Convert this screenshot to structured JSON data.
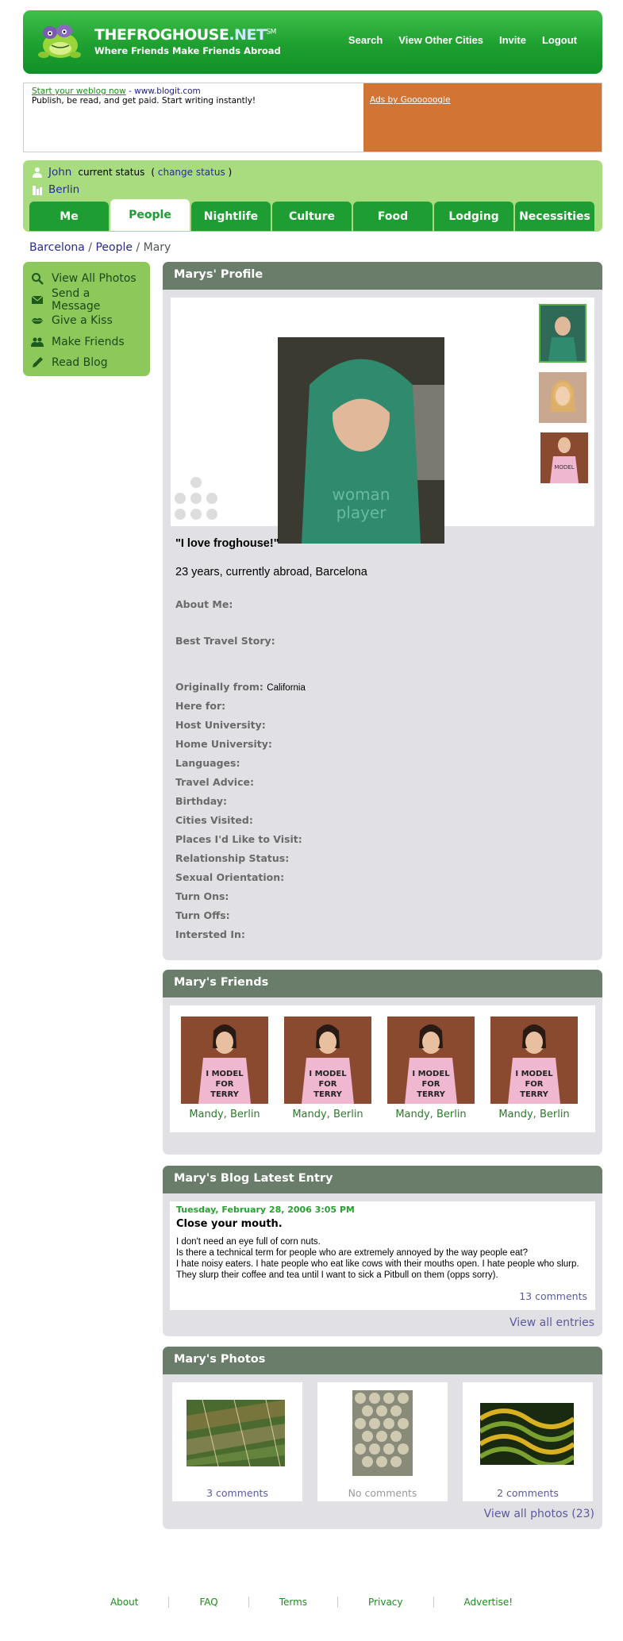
{
  "brand": {
    "name": "THEFROGHOUSE",
    "net": ".NET",
    "sm": "SM",
    "tagline": "Where Friends Make Friends Abroad"
  },
  "topnav": [
    "Search",
    "View Other Cities",
    "Invite",
    "Logout"
  ],
  "ads": {
    "link": "Start your weblog now",
    "url": "- www.blogit.com",
    "text": "Publish, be read, and get paid. Start writing instantly!",
    "google": "Ads by Goooooogle",
    "color": "#d27434"
  },
  "status": {
    "user": "John",
    "label": "current status",
    "open": "(",
    "change": "change status",
    "close": ")",
    "city": "Berlin"
  },
  "tabs": [
    "Me",
    "People",
    "Nightlife",
    "Culture",
    "Food",
    "Lodging",
    "Necessities"
  ],
  "active_tab": "People",
  "breadcrumb": {
    "city": "Barcelona",
    "sep1": " / ",
    "section": "People",
    "sep2": " / ",
    "current": "Mary"
  },
  "actions": [
    {
      "label": "View All Photos",
      "icon": "magnifier-icon"
    },
    {
      "label": "Send a Message",
      "icon": "envelope-icon"
    },
    {
      "label": "Give a Kiss",
      "icon": "lips-icon"
    },
    {
      "label": "Make Friends",
      "icon": "people-icon"
    },
    {
      "label": "Read Blog",
      "icon": "pencil-icon"
    }
  ],
  "profile": {
    "title": "Marys' Profile",
    "quote": "\"I love froghouse!\"",
    "age": "23 years, currently abroad, Barcelona",
    "fields": [
      {
        "label": "About Me:",
        "value": ""
      },
      {
        "label": "Best Travel Story:",
        "value": ""
      },
      {
        "label": "Originally from:",
        "value": "California"
      },
      {
        "label": "Here for:",
        "value": ""
      },
      {
        "label": "Host University:",
        "value": ""
      },
      {
        "label": "Home University:",
        "value": ""
      },
      {
        "label": "Languages:",
        "value": ""
      },
      {
        "label": "Travel Advice:",
        "value": ""
      },
      {
        "label": "Birthday:",
        "value": ""
      },
      {
        "label": "Cities Visited:",
        "value": ""
      },
      {
        "label": "Places I'd Like to Visit:",
        "value": ""
      },
      {
        "label": "Relationship Status:",
        "value": ""
      },
      {
        "label": "Sexual Orientation:",
        "value": ""
      },
      {
        "label": "Turn Ons:",
        "value": ""
      },
      {
        "label": "Turn Offs:",
        "value": ""
      },
      {
        "label": "Intersted In:",
        "value": ""
      }
    ]
  },
  "friends": {
    "title": "Mary's Friends",
    "list": [
      "Mandy, Berlin",
      "Mandy, Berlin",
      "Mandy, Berlin",
      "Mandy, Berlin"
    ],
    "shirt_text": "I MODEL FOR TERRY"
  },
  "blog": {
    "title": "Mary's Blog Latest Entry",
    "date": "Tuesday, February 28, 2006 3:05 PM",
    "entry_title": "Close your mouth.",
    "lines": [
      "I don't need an eye full of corn nuts.",
      "Is there a technical term for people who are extremely annoyed by the way people eat?",
      "I hate noisy eaters. I hate people who eat like cows with their mouths open. I hate people who slurp. They slurp their coffee and tea until I want to sick a Pitbull on them (opps sorry)."
    ],
    "comments": "13 comments",
    "view_all": "View all entries"
  },
  "photos": {
    "title": "Mary's Photos",
    "items": [
      {
        "comments": "3 comments"
      },
      {
        "comments": "No comments"
      },
      {
        "comments": "2 comments"
      }
    ],
    "view_all": "View all photos (23)"
  },
  "footer": [
    "About",
    "FAQ",
    "Terms",
    "Privacy",
    "Advertise!"
  ]
}
